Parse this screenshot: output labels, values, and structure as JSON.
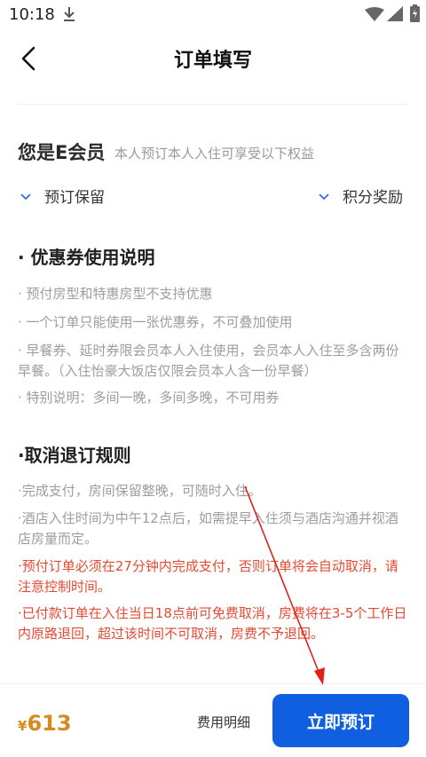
{
  "status_bar": {
    "time": "10:18"
  },
  "header": {
    "title": "订单填写"
  },
  "member": {
    "title": "您是E会员",
    "description": "本人预订本人入住可享受以下权益",
    "benefits": [
      "预订保留",
      "积分奖励"
    ]
  },
  "coupon_section": {
    "title": "· 优惠券使用说明",
    "items": [
      "· 预付房型和特惠房型不支持优惠",
      "· 一个订单只能使用一张优惠券，不可叠加使用",
      "· 早餐券、延时券限会员本人入住使用，会员本人入住至多含两份早餐。（入住怡豪大饭店仅限会员本人含一份早餐）",
      "· 特别说明：多间一晚，多间多晚，不可用券"
    ]
  },
  "cancel_section": {
    "title": "·取消退订规则",
    "items": [
      "·完成支付，房间保留整晚，可随时入住。",
      "·酒店入住时间为中午12点后，如需提早入住须与酒店沟通并视酒店房量而定。",
      "·预付订单必须在27分钟内完成支付，否则订单将会自动取消，请注意控制时间。",
      "·已付款订单在入住当日18点前可免费取消，房费将在3-5个工作日内原路退回，超过该时间不可取消，房费不予退回。"
    ]
  },
  "bottom_bar": {
    "currency": "¥",
    "price": "613",
    "fee_detail_label": "费用明细",
    "book_label": "立即预订"
  },
  "colors": {
    "accent": "#0f5fe0",
    "price": "#d88a1e",
    "warning": "#e34a33",
    "annotation": "#e0201b"
  }
}
